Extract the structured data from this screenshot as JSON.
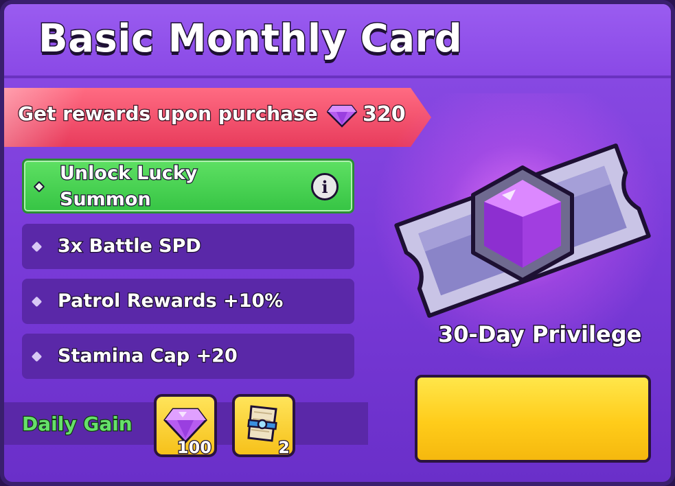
{
  "header": {
    "title": "Basic Monthly Card"
  },
  "banner": {
    "text": "Get rewards upon purchase",
    "icon": "purple-gem-icon",
    "value": "320"
  },
  "features": [
    {
      "label_line1": "Unlock Lucky",
      "label_line2": "Summon",
      "highlighted": true,
      "icon": "info-icon",
      "icon_glyph": "i"
    },
    {
      "label": "3x Battle SPD"
    },
    {
      "label": "Patrol Rewards +10%"
    },
    {
      "label": "Stamina Cap +20"
    }
  ],
  "daily_gain": {
    "label": "Daily Gain",
    "rewards": [
      {
        "icon": "purple-gem-icon",
        "count": "100"
      },
      {
        "icon": "scroll-icon",
        "count": "2"
      }
    ]
  },
  "privilege": {
    "icon": "gem-ticket-icon",
    "label": "30-Day Privilege"
  },
  "colors": {
    "panel": "#7a3bd9",
    "banner": "#e83c5c",
    "highlight": "#4fd95a",
    "feature_row": "#5a28a8",
    "button": "#ffcc1a",
    "daily_gain_text": "#66e06a"
  }
}
